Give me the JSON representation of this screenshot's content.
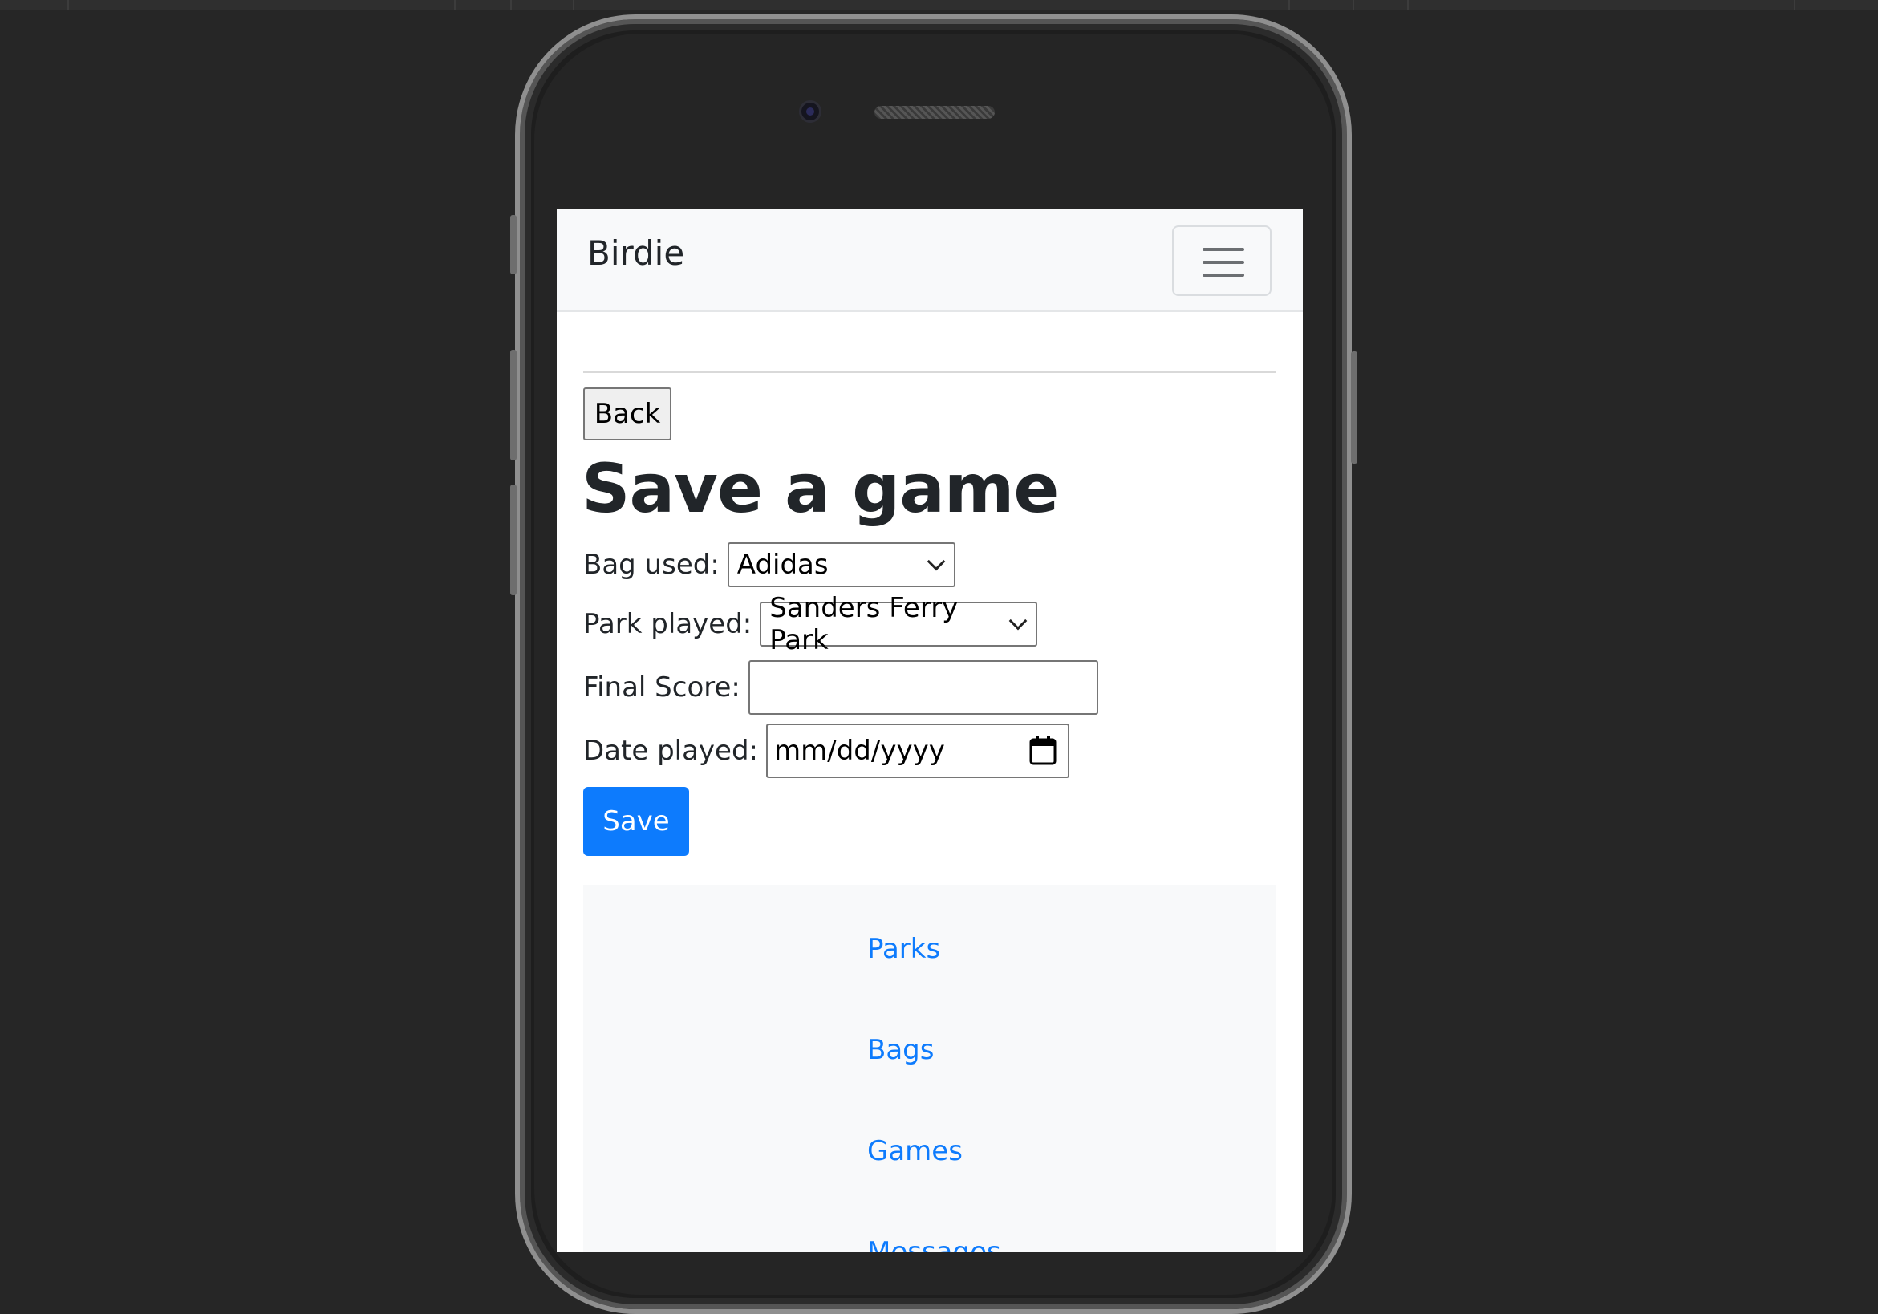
{
  "navbar": {
    "brand": "Birdie",
    "menu_icon": "hamburger-menu-icon"
  },
  "page": {
    "back_label": "Back",
    "title": "Save a game"
  },
  "form": {
    "bag_label": "Bag used:",
    "bag_value": "Adidas",
    "park_label": "Park played:",
    "park_value": "Sanders Ferry Park",
    "score_label": "Final Score:",
    "score_value": "",
    "date_label": "Date played:",
    "date_placeholder": "mm/dd/yyyy",
    "date_icon": "calendar-icon",
    "save_label": "Save"
  },
  "footer": {
    "links": [
      {
        "label": "Parks"
      },
      {
        "label": "Bags"
      },
      {
        "label": "Games"
      },
      {
        "label": "Messages"
      }
    ]
  },
  "colors": {
    "primary": "#0d7bfd",
    "navbar_bg": "#f8f9fa",
    "device_bg": "#262626"
  }
}
